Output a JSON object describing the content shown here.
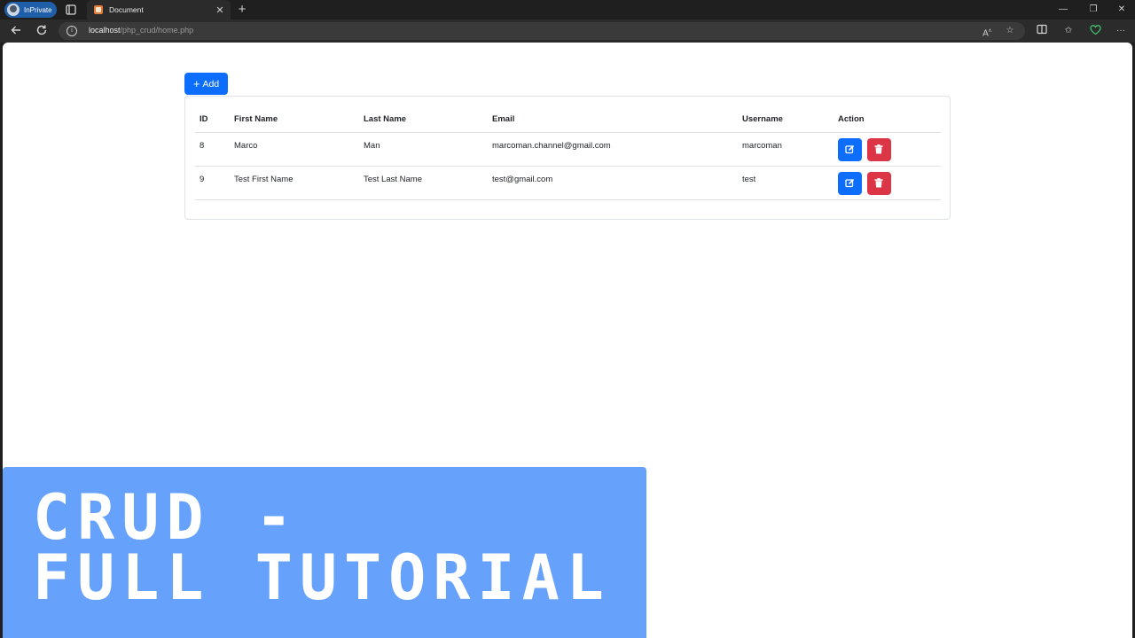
{
  "browser": {
    "profile_label": "InPrivate",
    "tab_title": "Document",
    "url_host": "localhost",
    "url_path": "/php_crud/home.php"
  },
  "page": {
    "add_label": "Add",
    "table": {
      "headers": [
        "ID",
        "First Name",
        "Last Name",
        "Email",
        "Username",
        "Action"
      ],
      "rows": [
        {
          "id": "8",
          "first_name": "Marco",
          "last_name": "Man",
          "email": "marcoman.channel@gmail.com",
          "username": "marcoman"
        },
        {
          "id": "9",
          "first_name": "Test First Name",
          "last_name": "Test Last Name",
          "email": "test@gmail.com",
          "username": "test"
        }
      ]
    }
  },
  "banner": {
    "line1": "CRUD -",
    "line2": "FULL TUTORIAL"
  },
  "colors": {
    "primary": "#0d6efd",
    "danger": "#dc3545",
    "banner": "#66a1fb"
  }
}
